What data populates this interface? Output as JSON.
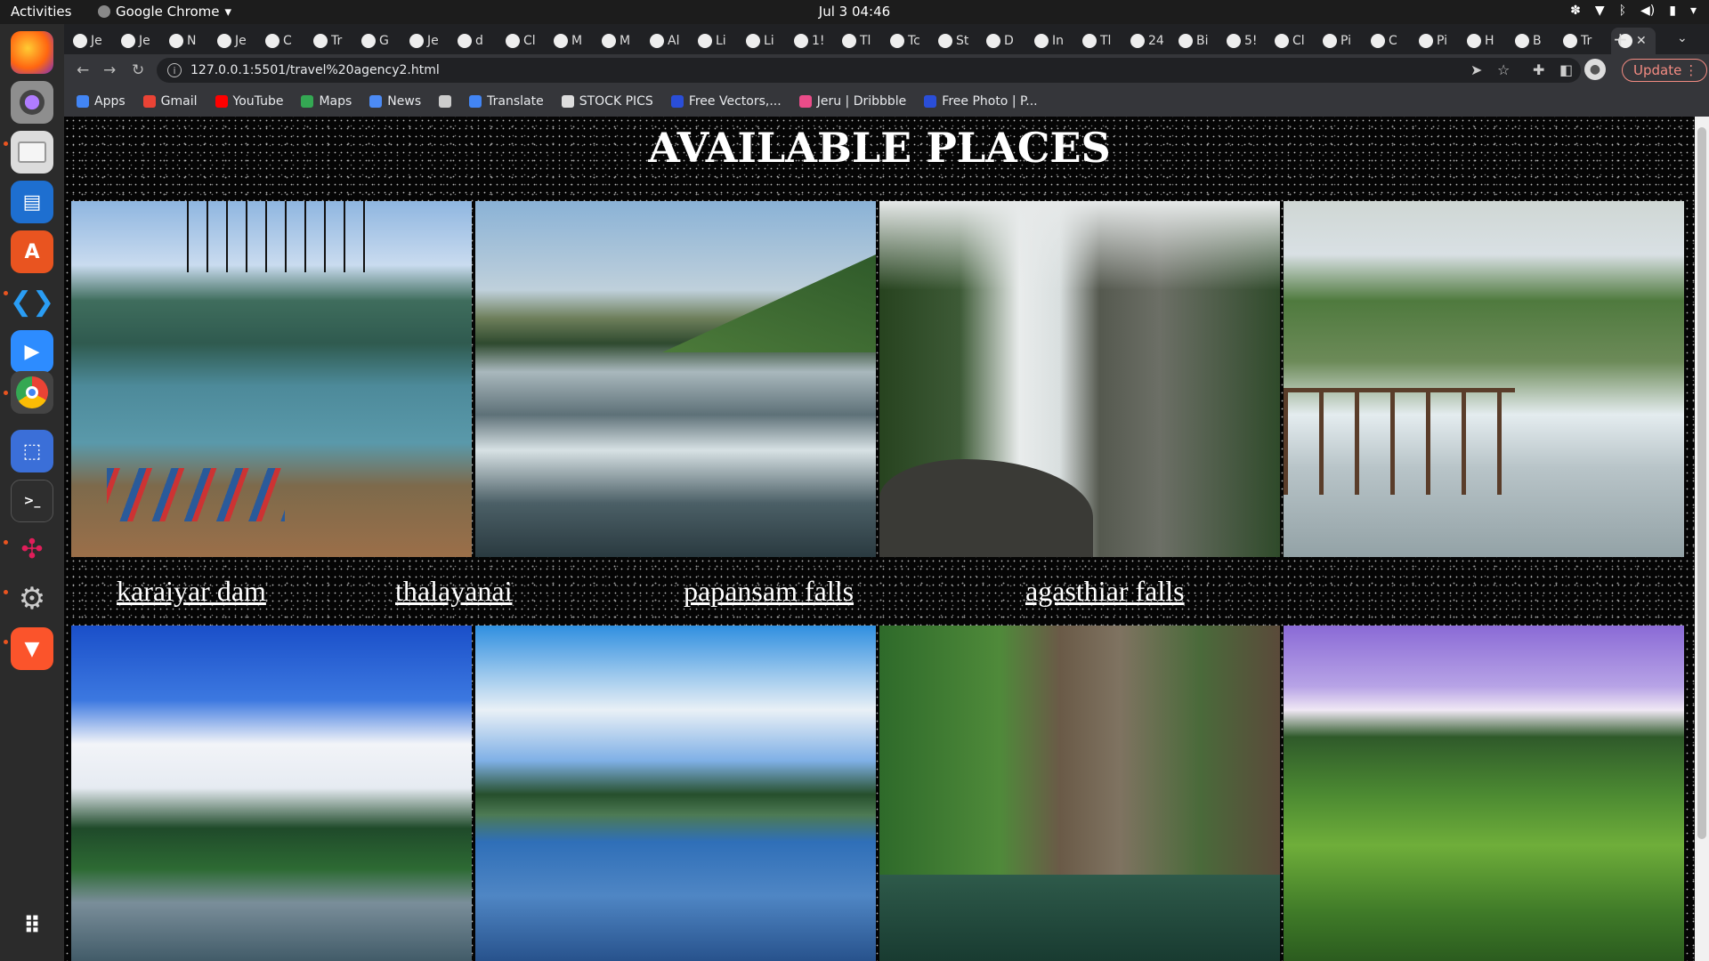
{
  "system": {
    "activities": "Activities",
    "app_name": "Google Chrome",
    "clock": "Jul 3  04:46"
  },
  "tabs": [
    "Je",
    "Je",
    "N",
    "Je",
    "C",
    "Tr",
    "G",
    "Je",
    "d",
    "Cl",
    "M",
    "M",
    "Al",
    "Li",
    "Li",
    "1!",
    "Tl",
    "Tc",
    "St",
    "D",
    "In",
    "Tl",
    "24",
    "Bi",
    "5!",
    "Cl",
    "Pi",
    "C",
    "Pi",
    "H",
    "B",
    "Tr"
  ],
  "toolbar": {
    "url": "127.0.0.1:5501/travel%20agency2.html",
    "update_label": "Update"
  },
  "bookmarks": [
    {
      "label": "Apps",
      "color": "#4285f4"
    },
    {
      "label": "Gmail",
      "color": "#ea4335"
    },
    {
      "label": "YouTube",
      "color": "#ff0000"
    },
    {
      "label": "Maps",
      "color": "#34a853"
    },
    {
      "label": "News",
      "color": "#4c8bf5"
    },
    {
      "label": "",
      "color": "#cccccc"
    },
    {
      "label": "Translate",
      "color": "#4285f4"
    },
    {
      "label": "STOCK PICS",
      "color": "#dddddd"
    },
    {
      "label": "Free Vectors,...",
      "color": "#2a4ed8"
    },
    {
      "label": "Jeru | Dribbble",
      "color": "#ea4c89"
    },
    {
      "label": "Free Photo | P...",
      "color": "#2a4ed8"
    }
  ],
  "page": {
    "heading": "AVAILABLE PLACES",
    "places": [
      "karaiyar dam",
      "thalayanai",
      "papansam falls",
      "agasthiar falls"
    ]
  },
  "colors": {
    "topbar": "#1c1c1c",
    "dock": "#2b2b2b",
    "tabstrip": "#202124",
    "toolbar": "#35363a",
    "heading": "#ffffff",
    "update": "#f28b82"
  },
  "icons": [
    "firefox-icon",
    "screenshot-icon",
    "files-icon",
    "writer-icon",
    "software-icon",
    "vscode-icon",
    "zoom-icon",
    "chrome-icon",
    "screen-recorder-icon",
    "terminal-icon",
    "slack-icon",
    "settings-icon",
    "brave-icon",
    "app-grid-icon"
  ]
}
